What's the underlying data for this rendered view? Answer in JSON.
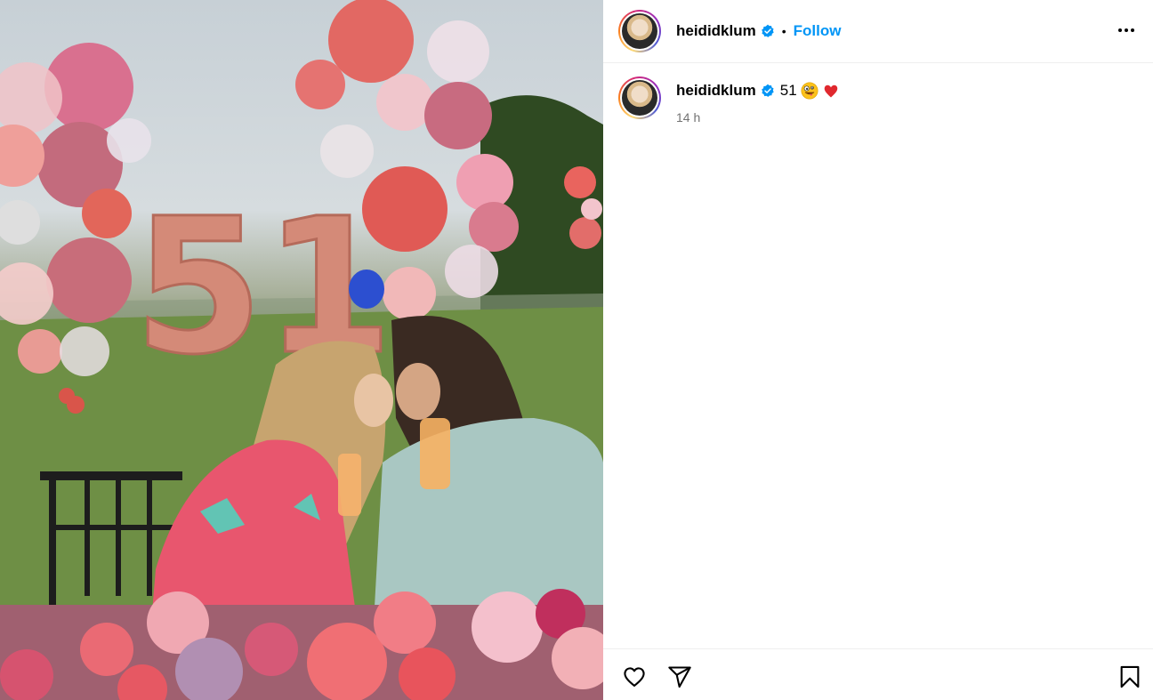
{
  "post": {
    "username": "heididklum",
    "follow_label": "Follow",
    "separator": "•",
    "caption_text": "51",
    "caption_emojis": [
      "zany-face-emoji",
      "red-heart-emoji"
    ],
    "timestamp": "14 h"
  },
  "photo": {
    "balloon_number": "51"
  },
  "colors": {
    "follow_blue": "#0095f6",
    "verified_blue": "#0095f6",
    "timestamp_gray": "#737373",
    "divider": "#efefef"
  },
  "icons": {
    "more": "more-options-icon",
    "like": "heart-outline-icon",
    "share": "share-icon",
    "save": "bookmark-icon"
  }
}
